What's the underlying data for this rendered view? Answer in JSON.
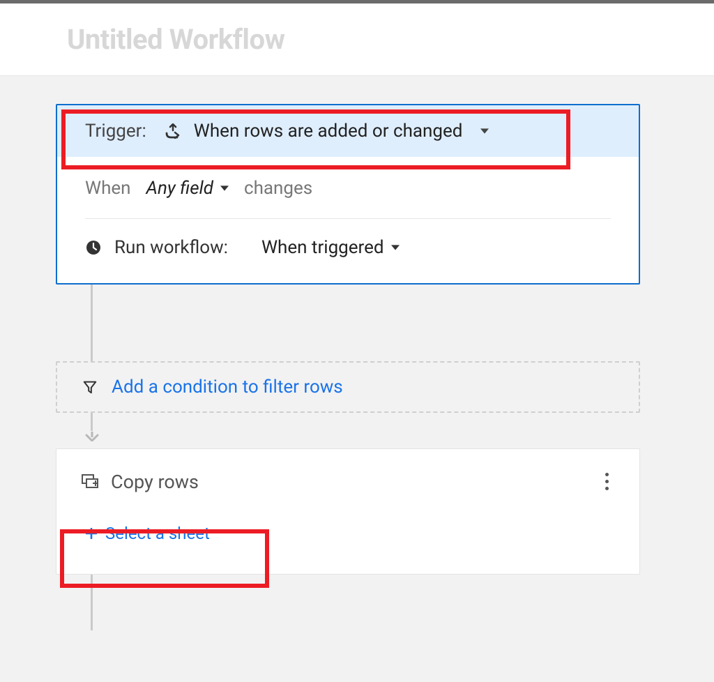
{
  "header": {
    "title": "Untitled Workflow"
  },
  "trigger": {
    "label": "Trigger:",
    "value": "When rows are added or changed",
    "when_label": "When",
    "field_selector": "Any field",
    "changes_label": "changes",
    "run_label": "Run workflow:",
    "run_value": "When triggered"
  },
  "condition": {
    "link_text": "Add a condition to filter rows"
  },
  "action": {
    "title": "Copy rows",
    "select_sheet": "Select a sheet"
  }
}
